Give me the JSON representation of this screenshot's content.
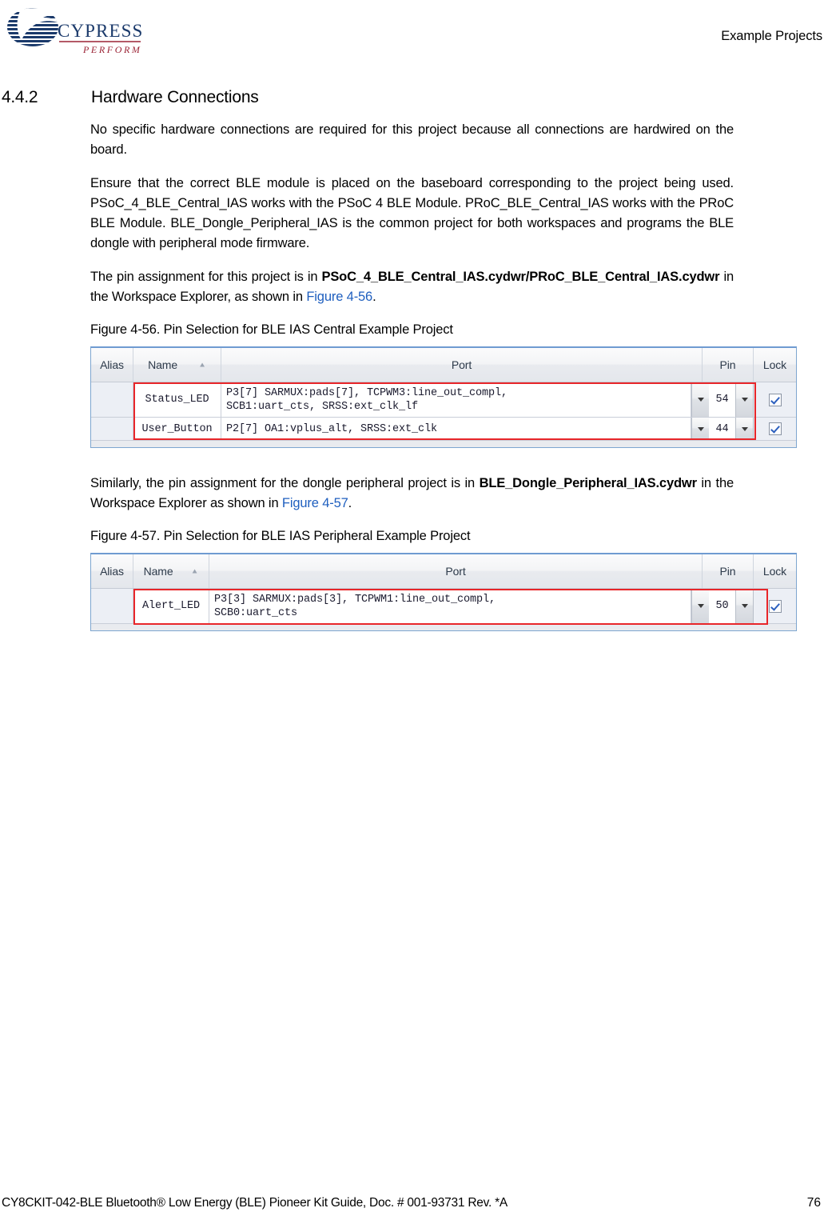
{
  "header": {
    "logo_alt": "Cypress Perform",
    "logo_wordmark": "CYPRESS",
    "logo_tagline": "PERFORM",
    "title": "Example Projects"
  },
  "section": {
    "number": "4.4.2",
    "title": "Hardware Connections"
  },
  "paragraphs": {
    "p1": "No specific hardware connections are required for this project because all connections are hardwired on the board.",
    "p2": "Ensure that the correct BLE module is placed on the baseboard corresponding to the project being used. PSoC_4_BLE_Central_IAS works with the PSoC 4 BLE Module. PRoC_BLE_Central_IAS works with the PRoC BLE Module. BLE_Dongle_Peripheral_IAS is the common project for both workspaces and programs the BLE dongle with peripheral mode firmware.",
    "p3_a": "The pin assignment for this project is in ",
    "p3_bold1": "PSoC_4_BLE_Central_IAS.cydwr/",
    "p3_bold2": "PRoC_BLE_Central_IAS.cydwr",
    "p3_b": " in the Workspace Explorer, as shown in ",
    "p3_link": "Figure 4-56",
    "p3_c": ".",
    "p4_a": "Similarly, the pin assignment for the dongle peripheral project is in ",
    "p4_bold": "BLE_Dongle_Peripheral_IAS.cydwr",
    "p4_b": " in the Workspace Explorer as shown in ",
    "p4_link": "Figure 4-57",
    "p4_c": "."
  },
  "figure1": {
    "caption": "Figure 4-56.  Pin Selection for BLE IAS Central Example Project",
    "columns": [
      "Alias",
      "Name",
      "Port",
      "Pin",
      "Lock"
    ],
    "sort_indicator": "▲",
    "rows": [
      {
        "alias": "",
        "name": "Status_LED",
        "port": "P3[7] SARMUX:pads[7], TCPWM3:line_out_compl,\nSCB1:uart_cts, SRSS:ext_clk_lf",
        "pin": "54",
        "locked": true
      },
      {
        "alias": "",
        "name": "User_Button",
        "port": "P2[7] OA1:vplus_alt, SRSS:ext_clk",
        "pin": "44",
        "locked": true
      }
    ]
  },
  "figure2": {
    "caption": "Figure 4-57.  Pin Selection for BLE IAS Peripheral Example Project",
    "columns": [
      "Alias",
      "Name",
      "Port",
      "Pin",
      "Lock"
    ],
    "sort_indicator": "▲",
    "rows": [
      {
        "alias": "",
        "name": "Alert_LED",
        "port": "P3[3] SARMUX:pads[3], TCPWM1:line_out_compl,\nSCB0:uart_cts",
        "pin": "50",
        "locked": true
      }
    ]
  },
  "footer": {
    "text": "CY8CKIT-042-BLE Bluetooth® Low Energy (BLE) Pioneer Kit Guide, Doc. # 001-93731 Rev. *A",
    "page": "76"
  },
  "colors": {
    "highlight": "#e8262a",
    "link": "#1f5fbf",
    "logo_blue": "#1b3a6b",
    "logo_red": "#9b2335"
  }
}
